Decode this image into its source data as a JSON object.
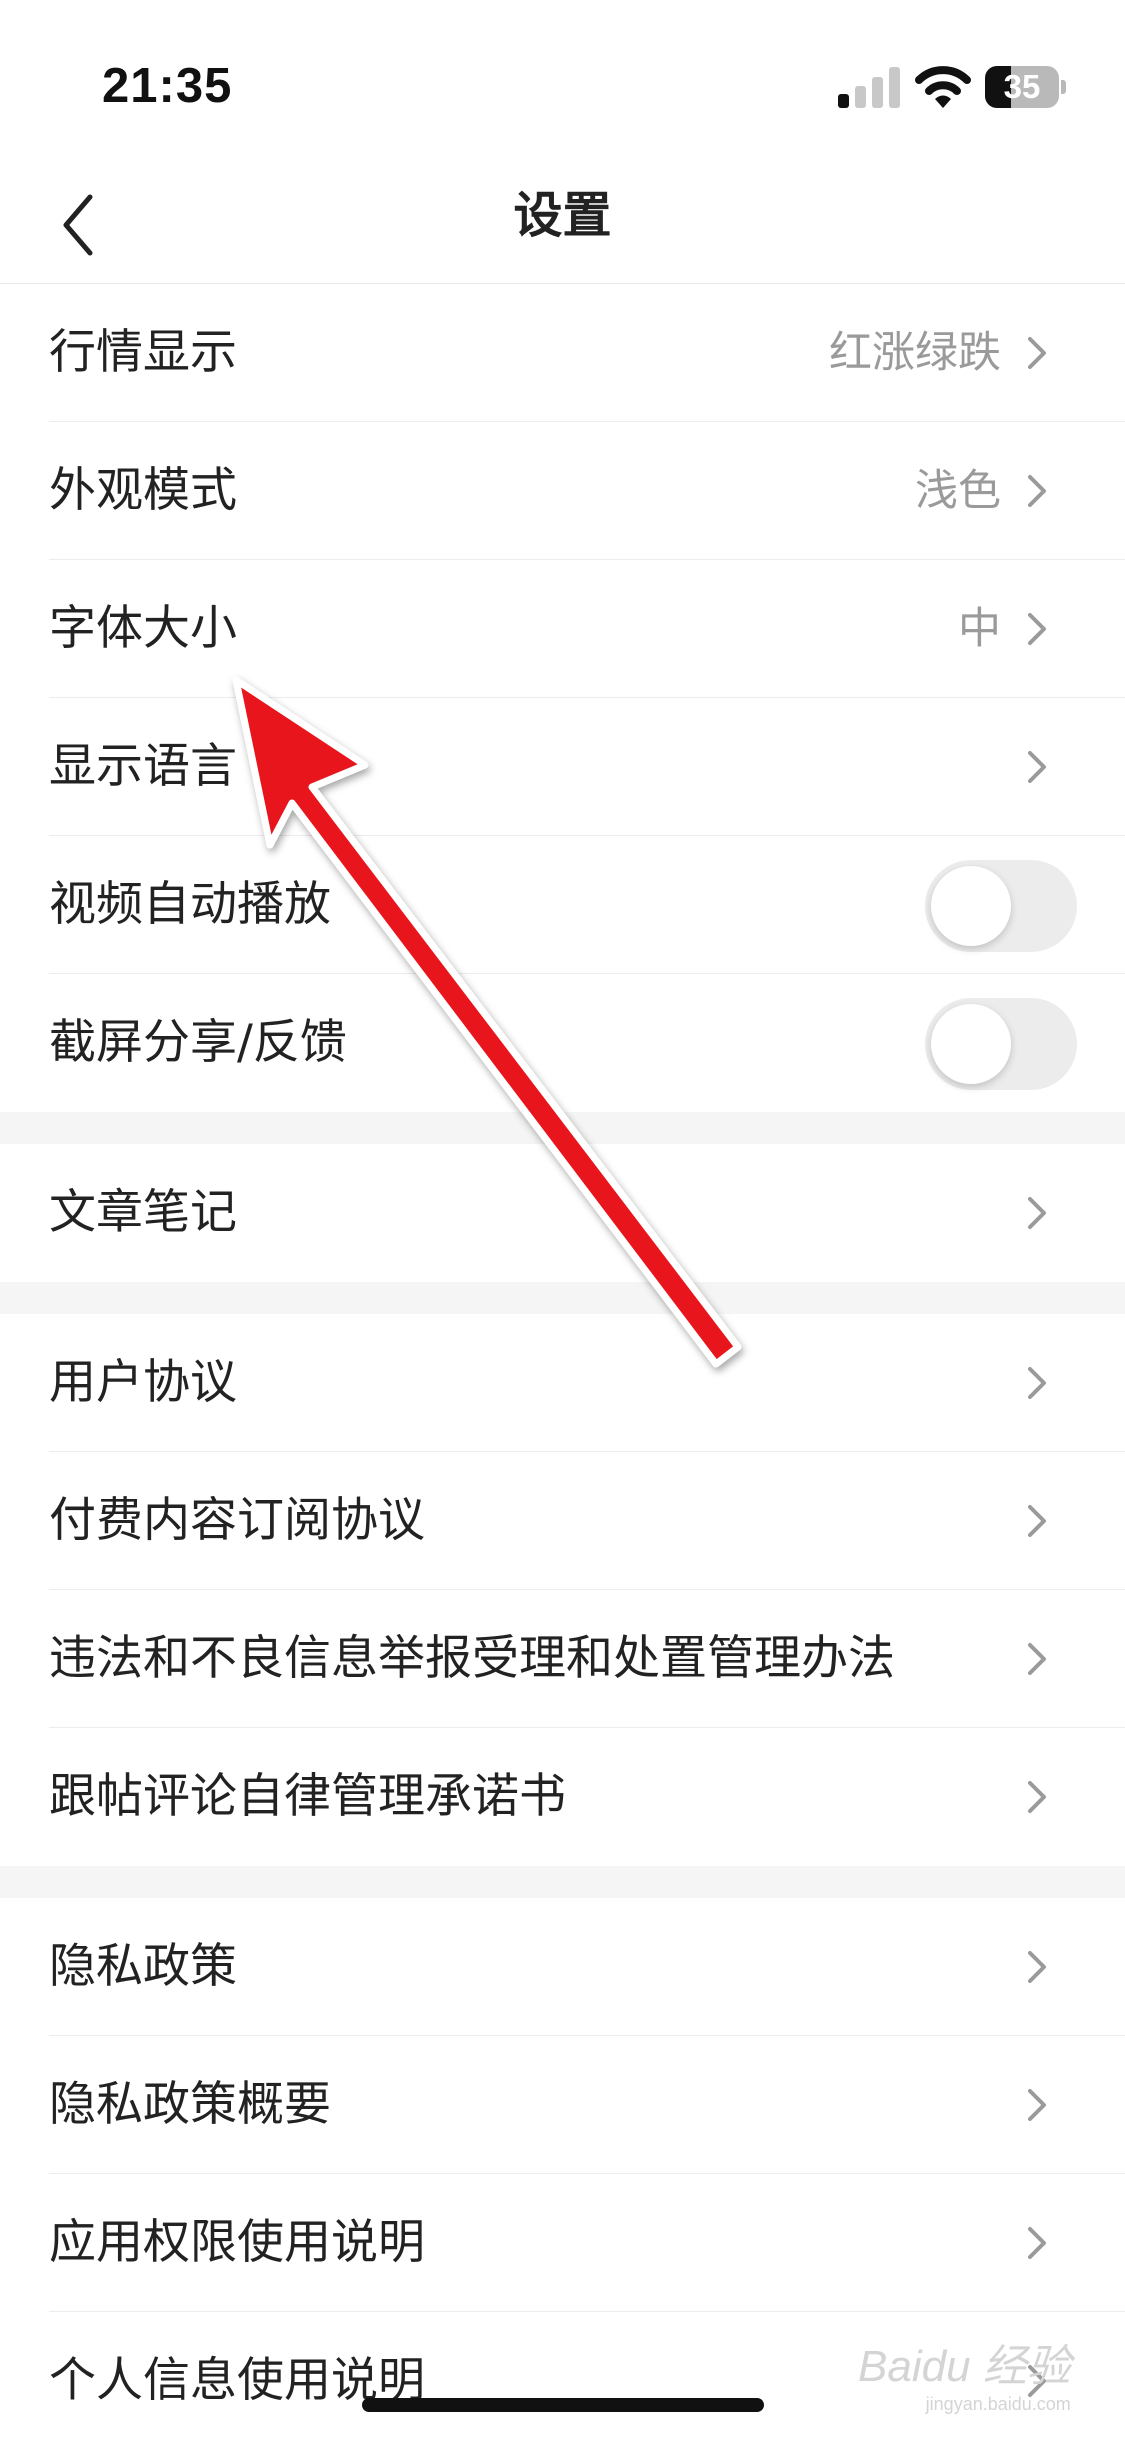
{
  "status_bar": {
    "time": "21:35",
    "battery": "35",
    "battery_level": 0.35
  },
  "nav": {
    "title": "设置",
    "back_icon": "chevron-left-icon"
  },
  "group1": [
    {
      "label": "行情显示",
      "value": "红涨绿跌",
      "type": "link"
    },
    {
      "label": "外观模式",
      "value": "浅色",
      "type": "link"
    },
    {
      "label": "字体大小",
      "value": "中",
      "type": "link"
    },
    {
      "label": "显示语言",
      "value": "",
      "type": "link"
    },
    {
      "label": "视频自动播放",
      "type": "toggle",
      "on": false
    },
    {
      "label": "截屏分享/反馈",
      "type": "toggle",
      "on": false
    }
  ],
  "group2": [
    {
      "label": "文章笔记",
      "type": "link"
    }
  ],
  "group3": [
    {
      "label": "用户协议",
      "type": "link"
    },
    {
      "label": "付费内容订阅协议",
      "type": "link"
    },
    {
      "label": "违法和不良信息举报受理和处置管理办法",
      "type": "link"
    },
    {
      "label": "跟帖评论自律管理承诺书",
      "type": "link"
    }
  ],
  "group4": [
    {
      "label": "隐私政策",
      "type": "link"
    },
    {
      "label": "隐私政策概要",
      "type": "link"
    },
    {
      "label": "应用权限使用说明",
      "type": "link"
    },
    {
      "label": "个人信息使用说明",
      "type": "link"
    }
  ],
  "watermark": {
    "text": "Baidu 经验",
    "sub": "jingyan.baidu.com"
  },
  "colors": {
    "arrow": "#e8121b",
    "divider": "#ececec",
    "section_gap": "#f5f5f5",
    "value_text": "#9a9a9a"
  }
}
